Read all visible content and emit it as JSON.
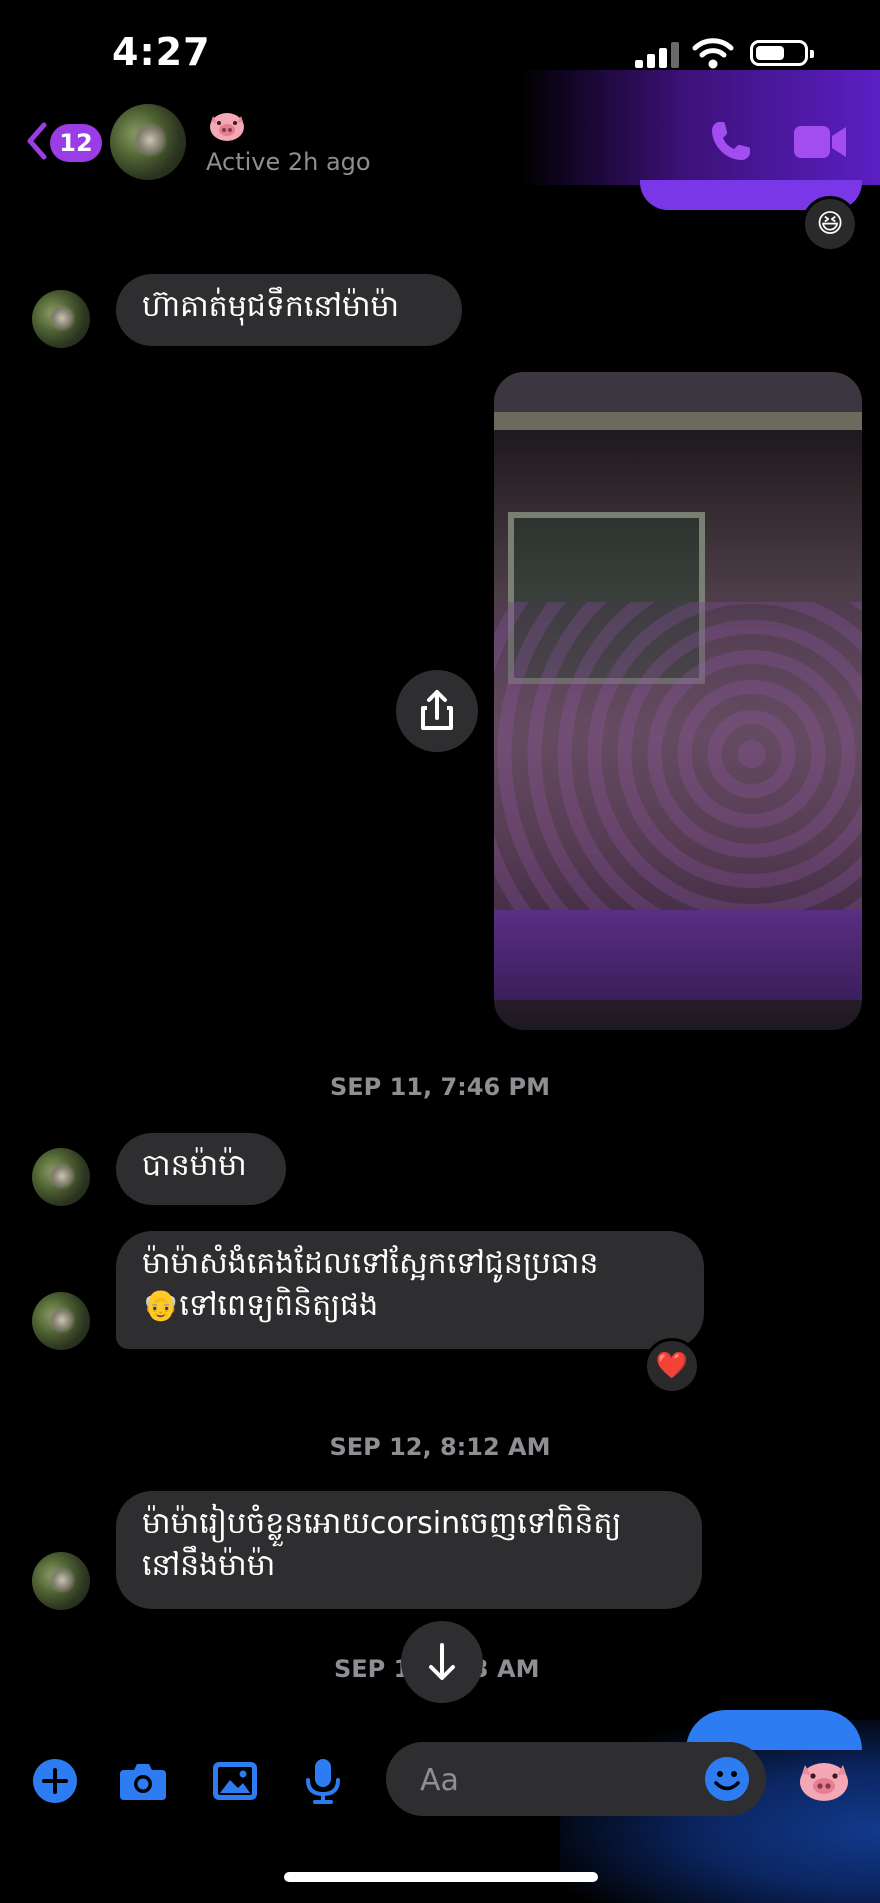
{
  "status_bar": {
    "time": "4:27"
  },
  "header": {
    "back_badge": "12",
    "contact_emoji": "🐷",
    "active_status": "Active 2h ago",
    "icons": [
      "back-chevron-icon",
      "phone-icon",
      "video-camera-icon"
    ],
    "accent_color": "#9b3de6"
  },
  "messages": [
    {
      "type": "reaction",
      "emoji": "😆"
    },
    {
      "type": "incoming",
      "text": "ហ៊ាគាត់មុជទឹកនៅម៉ាម៉ា"
    },
    {
      "type": "outgoing-photo",
      "share_icon": "share-icon"
    },
    {
      "type": "date",
      "text": "SEP 11, 7:46 PM"
    },
    {
      "type": "incoming",
      "text": "បានម៉ាម៉ា"
    },
    {
      "type": "incoming",
      "line1": "ម៉ាម៉ាសំងំគេងដែលទៅស្អែកទៅជូនប្រធាន",
      "line2_emoji": "👴",
      "line2": "ទៅពេទ្យពិនិត្យផង",
      "reaction": "❤️"
    },
    {
      "type": "date",
      "text": "SEP 12, 8:12 AM"
    },
    {
      "type": "incoming",
      "line1": "ម៉ាម៉ារៀបចំខ្លួនអោយcorsinចេញទៅពិនិត្យ",
      "line2": "នៅនឹងម៉ាម៉ា"
    },
    {
      "type": "date",
      "text_left": "SEP 1",
      "text_right": "3 AM"
    }
  ],
  "composer": {
    "placeholder": "Aa",
    "icons": [
      "plus-icon",
      "camera-icon",
      "gallery-icon",
      "microphone-icon",
      "emoji-icon",
      "pig-quick-reaction-icon"
    ],
    "quick_reaction": "🐷",
    "accent_color": "#2d7cf2"
  }
}
